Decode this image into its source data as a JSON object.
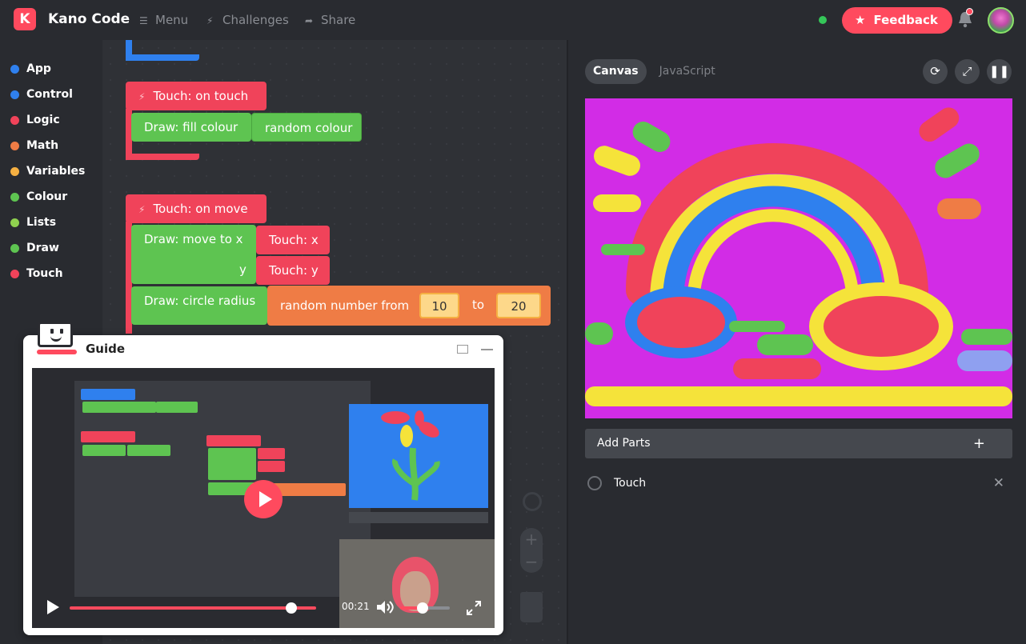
{
  "app": {
    "title": "Kano Code",
    "logo_letter": "K",
    "accent_color": "#ff4a5e"
  },
  "nav": {
    "menu": "Menu",
    "challenges": "Challenges",
    "share": "Share",
    "feedback": "Feedback"
  },
  "categories": [
    {
      "label": "App",
      "color": "#2f80ee"
    },
    {
      "label": "Control",
      "color": "#2f80ee"
    },
    {
      "label": "Logic",
      "color": "#f0435a"
    },
    {
      "label": "Math",
      "color": "#ef7c45"
    },
    {
      "label": "Variables",
      "color": "#f5b042"
    },
    {
      "label": "Colour",
      "color": "#5ec451"
    },
    {
      "label": "Lists",
      "color": "#8fd14f"
    },
    {
      "label": "Draw",
      "color": "#5ec451"
    },
    {
      "label": "Touch",
      "color": "#f0435a"
    }
  ],
  "blocks": {
    "touch_on_touch": "Touch: on touch",
    "fill_colour": "Draw: fill colour",
    "random_colour": "random colour",
    "touch_on_move": "Touch: on move",
    "move_to_x": "Draw: move to x",
    "y_label": "y",
    "touch_x": "Touch: x",
    "touch_y": "Touch: y",
    "circle_radius": "Draw: circle radius",
    "random_number_from": "random number from",
    "to_label": "to",
    "from_value": "10",
    "to_value": "20"
  },
  "panel": {
    "tab_canvas": "Canvas",
    "tab_javascript": "JavaScript",
    "add_parts": "Add Parts",
    "add_parts_plus": "+",
    "part_touch": "Touch",
    "part_remove": "✕"
  },
  "guide": {
    "title": "Guide",
    "video_time": "00:21",
    "video_progress": 0.9,
    "volume_level": 0.45
  }
}
